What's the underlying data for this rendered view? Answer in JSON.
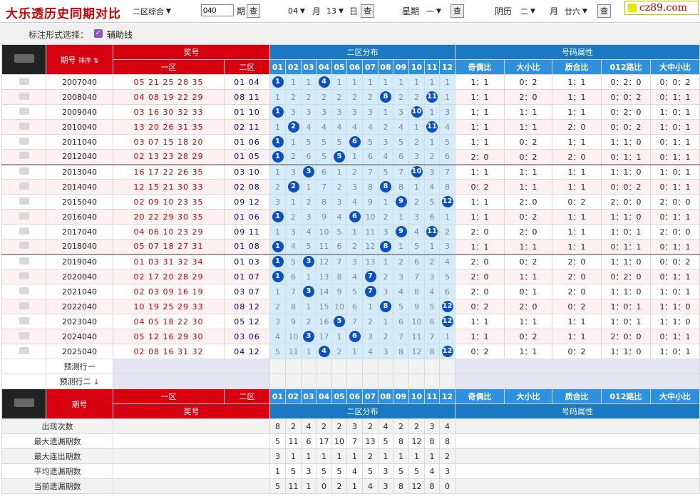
{
  "title": "大乐透历史同期对比",
  "top": {
    "zone_select": "二区综合",
    "issue_value": "040",
    "issue_label": "期",
    "query_label": "查",
    "month_value": "04",
    "month_label": "月",
    "day_value": "13",
    "day_label": "日",
    "week_label": "星期",
    "week_value": "一",
    "lunar_label": "阴历",
    "lunar_month": "二",
    "lunar_month_label": "月",
    "lunar_day": "廿六"
  },
  "logo": "cz89.com",
  "options": {
    "label": "标注形式选择：",
    "aux_line": "辅助线",
    "check": "✓"
  },
  "headers": {
    "issue": "期号",
    "sort": "排序",
    "prize": "奖号",
    "zone1": "一区",
    "zone2": "二区",
    "dist": "二区分布",
    "attrs": "号码属性",
    "attr_cols": [
      "奇偶比",
      "大小比",
      "质合比",
      "012路比",
      "大中小比"
    ],
    "nums": [
      "01",
      "02",
      "03",
      "04",
      "05",
      "06",
      "07",
      "08",
      "09",
      "10",
      "11",
      "12"
    ]
  },
  "rows": [
    {
      "issue": "2007040",
      "z1": "05 21 25 28 35",
      "z2": "01 04",
      "cells": [
        "B1",
        "1",
        "1",
        "B4",
        "1",
        "1",
        "1",
        "1",
        "1",
        "1",
        "1",
        "1"
      ],
      "attrs": [
        "1：1",
        "0：2",
        "1：1",
        "0：2：0",
        "0：0：2"
      ]
    },
    {
      "issue": "2008040",
      "z1": "04 08 19 22 29",
      "z2": "08 11",
      "cells": [
        "1",
        "2",
        "2",
        "2",
        "2",
        "2",
        "2",
        "B8",
        "2",
        "2",
        "B11",
        "1"
      ],
      "attrs": [
        "1：1",
        "2：0",
        "1：1",
        "0：0：2",
        "0：1：1"
      ]
    },
    {
      "issue": "2009040",
      "z1": "03 16 30 32 33",
      "z2": "01 10",
      "cells": [
        "B1",
        "3",
        "3",
        "3",
        "3",
        "3",
        "3",
        "1",
        "3",
        "B10",
        "1",
        "3"
      ],
      "attrs": [
        "1：1",
        "1：1",
        "1：1",
        "0：2：0",
        "1：0：1"
      ]
    },
    {
      "issue": "2010040",
      "z1": "13 20 26 31 35",
      "z2": "02 11",
      "cells": [
        "1",
        "B2",
        "4",
        "4",
        "4",
        "4",
        "4",
        "2",
        "4",
        "1",
        "B11",
        "4"
      ],
      "attrs": [
        "1：1",
        "1：1",
        "2：0",
        "0：0：2",
        "1：0：1"
      ]
    },
    {
      "issue": "2011040",
      "z1": "03 07 15 18 20",
      "z2": "01 06",
      "cells": [
        "B1",
        "1",
        "5",
        "5",
        "5",
        "B6",
        "5",
        "3",
        "5",
        "2",
        "1",
        "5"
      ],
      "attrs": [
        "1：1",
        "0：2",
        "1：1",
        "1：1：0",
        "0：1：1"
      ]
    },
    {
      "issue": "2012040",
      "z1": "02 13 23 28 29",
      "z2": "01 05",
      "cells": [
        "B1",
        "2",
        "6",
        "5",
        "B5",
        "1",
        "6",
        "4",
        "6",
        "3",
        "2",
        "6"
      ],
      "attrs": [
        "2：0",
        "0：2",
        "2：0",
        "0：1：1",
        "0：1：1"
      ]
    },
    {
      "issue": "2013040",
      "z1": "16 17 22 26 35",
      "z2": "03 10",
      "cells": [
        "1",
        "3",
        "B3",
        "6",
        "1",
        "2",
        "7",
        "5",
        "7",
        "B10",
        "3",
        "7"
      ],
      "attrs": [
        "1：1",
        "1：1",
        "1：1",
        "1：1：0",
        "1：0：1"
      ]
    },
    {
      "issue": "2014040",
      "z1": "12 15 21 30 33",
      "z2": "02 08",
      "cells": [
        "2",
        "B2",
        "1",
        "7",
        "2",
        "3",
        "8",
        "B8",
        "8",
        "1",
        "4",
        "8"
      ],
      "attrs": [
        "0：2",
        "1：1",
        "1：1",
        "0：0：2",
        "0：1：1"
      ]
    },
    {
      "issue": "2015040",
      "z1": "02 09 10 23 35",
      "z2": "09 12",
      "cells": [
        "3",
        "1",
        "2",
        "8",
        "3",
        "4",
        "9",
        "1",
        "B9",
        "2",
        "5",
        "B12"
      ],
      "attrs": [
        "1：1",
        "2：0",
        "0：2",
        "2：0：0",
        "2：0：0"
      ]
    },
    {
      "issue": "2016040",
      "z1": "20 22 29 30 35",
      "z2": "01 06",
      "cells": [
        "B1",
        "2",
        "3",
        "9",
        "4",
        "B6",
        "10",
        "2",
        "1",
        "3",
        "6",
        "1"
      ],
      "attrs": [
        "1：1",
        "0：2",
        "1：1",
        "1：1：0",
        "0：1：1"
      ]
    },
    {
      "issue": "2017040",
      "z1": "04 06 10 23 29",
      "z2": "09 11",
      "cells": [
        "1",
        "3",
        "4",
        "10",
        "5",
        "1",
        "11",
        "3",
        "B9",
        "4",
        "B11",
        "2"
      ],
      "attrs": [
        "2：0",
        "2：0",
        "1：1",
        "1：0：1",
        "2：0：0"
      ]
    },
    {
      "issue": "2018040",
      "z1": "05 07 18 27 31",
      "z2": "01 08",
      "cells": [
        "B1",
        "4",
        "5",
        "11",
        "6",
        "2",
        "12",
        "B8",
        "1",
        "5",
        "1",
        "3"
      ],
      "attrs": [
        "1：1",
        "1：1",
        "1：1",
        "0：1：1",
        "0：1：1"
      ]
    },
    {
      "issue": "2019040",
      "z1": "01 03 31 32 34",
      "z2": "01 03",
      "cells": [
        "B1",
        "5",
        "B3",
        "12",
        "7",
        "3",
        "13",
        "1",
        "2",
        "6",
        "2",
        "4"
      ],
      "attrs": [
        "2：0",
        "0：2",
        "2：0",
        "1：1：0",
        "0：0：2"
      ]
    },
    {
      "issue": "2020040",
      "z1": "02 17 20 28 29",
      "z2": "01 07",
      "cells": [
        "B1",
        "6",
        "1",
        "13",
        "8",
        "4",
        "B7",
        "2",
        "3",
        "7",
        "3",
        "5"
      ],
      "attrs": [
        "2：0",
        "1：1",
        "2：0",
        "0：2：0",
        "0：1：1"
      ]
    },
    {
      "issue": "2021040",
      "z1": "02 03 09 16 19",
      "z2": "03 07",
      "cells": [
        "1",
        "7",
        "B3",
        "14",
        "9",
        "5",
        "B7",
        "3",
        "4",
        "8",
        "4",
        "6"
      ],
      "attrs": [
        "2：0",
        "0：1",
        "2：0",
        "1：1：0",
        "1：0：1"
      ]
    },
    {
      "issue": "2022040",
      "z1": "10 19 25 29 33",
      "z2": "08 12",
      "cells": [
        "2",
        "8",
        "1",
        "15",
        "10",
        "6",
        "1",
        "B8",
        "5",
        "9",
        "5",
        "B12"
      ],
      "attrs": [
        "0：2",
        "2：0",
        "0：2",
        "1：0：1",
        "1：1：0"
      ]
    },
    {
      "issue": "2023040",
      "z1": "04 05 18 22 30",
      "z2": "05 12",
      "cells": [
        "3",
        "9",
        "2",
        "16",
        "B5",
        "7",
        "2",
        "1",
        "6",
        "10",
        "6",
        "B12"
      ],
      "attrs": [
        "1：1",
        "1：1",
        "1：1",
        "1：0：1",
        "1：1：0"
      ]
    },
    {
      "issue": "2024040",
      "z1": "05 12 16 29 30",
      "z2": "03 06",
      "cells": [
        "4",
        "10",
        "B3",
        "17",
        "1",
        "B6",
        "3",
        "2",
        "7",
        "11",
        "7",
        "1"
      ],
      "attrs": [
        "1：1",
        "0：2",
        "1：1",
        "2：0：0",
        "0：1：1"
      ]
    },
    {
      "issue": "2025040",
      "z1": "02 08 16 31 32",
      "z2": "04 12",
      "cells": [
        "5",
        "11",
        "1",
        "B4",
        "2",
        "1",
        "4",
        "3",
        "8",
        "12",
        "8",
        "B12"
      ],
      "attrs": [
        "0：2",
        "1：1",
        "0：2",
        "1：1：0",
        "1：0：1"
      ]
    }
  ],
  "predict": [
    "预测行一",
    "预测行二"
  ],
  "predict_arrow": "↓",
  "stats": [
    {
      "label": "出现次数",
      "values": [
        "8",
        "2",
        "4",
        "2",
        "2",
        "3",
        "2",
        "4",
        "2",
        "2",
        "3",
        "4"
      ]
    },
    {
      "label": "最大遗漏期数",
      "values": [
        "5",
        "11",
        "6",
        "17",
        "10",
        "7",
        "13",
        "5",
        "8",
        "12",
        "8",
        "8"
      ]
    },
    {
      "label": "最大连出期数",
      "values": [
        "3",
        "1",
        "1",
        "1",
        "1",
        "1",
        "2",
        "1",
        "1",
        "1",
        "1",
        "2"
      ]
    },
    {
      "label": "平均遗漏期数",
      "values": [
        "1",
        "5",
        "3",
        "5",
        "5",
        "4",
        "5",
        "3",
        "5",
        "5",
        "4",
        "3"
      ]
    },
    {
      "label": "当前遗漏期数",
      "values": [
        "5",
        "11",
        "1",
        "0",
        "2",
        "1",
        "4",
        "3",
        "8",
        "12",
        "8",
        "0"
      ]
    }
  ]
}
